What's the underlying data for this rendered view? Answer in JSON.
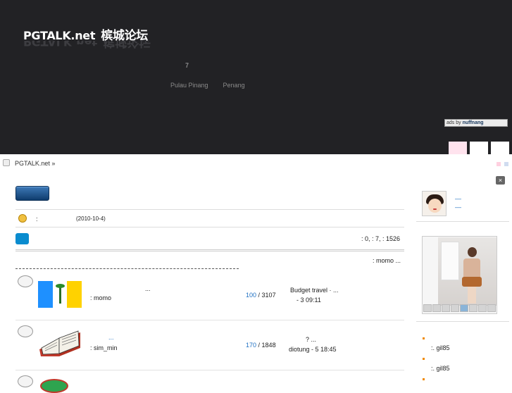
{
  "header": {
    "logo_text": "PGTALK.net",
    "logo_cn": "槟城论坛",
    "number": "7",
    "links": [
      "Pulau Pinang",
      "Penang"
    ],
    "ad_badge": {
      "prefix": "ads by",
      "brand": "nuffnang"
    },
    "color_squares": [
      "#ffe3ee",
      "#ffffff",
      "#ffffff"
    ]
  },
  "breadcrumb": {
    "text": "PGTALK.net »"
  },
  "announcement": {
    "colon": ":",
    "date": "(2010-10-4)"
  },
  "forum_stats": {
    "text": ": 0,   : 7,   : 1526"
  },
  "moderator": {
    "text": ":  momo  ..."
  },
  "forums": [
    {
      "icon": "penang-flag-icon",
      "title": "...",
      "moderator": ": momo",
      "today": "100",
      "threads": "3107",
      "last_post_title": "Budget travel ·   ...",
      "last_post_meta": "- 3   09:11"
    },
    {
      "icon": "open-book-icon",
      "title": "...",
      "moderator": ": sim_min",
      "today": "170",
      "threads": "1848",
      "last_post_title": "? ...",
      "last_post_meta": "diotung - 5   18:45"
    }
  ],
  "sidebar": {
    "close": "×",
    "user_links": [
      "—",
      "—"
    ],
    "users": [
      ":. gil85",
      ":. gil85"
    ]
  },
  "colors": {
    "header_bg": "#222225",
    "accent_blue": "#1e6fc2",
    "forum_btn": "#1d5594",
    "blue_box": "#0a8ccf",
    "bullet_orange": "#f08a00"
  },
  "flag_colors": [
    "#1e90ff",
    "#ffffff",
    "#ffd200"
  ]
}
